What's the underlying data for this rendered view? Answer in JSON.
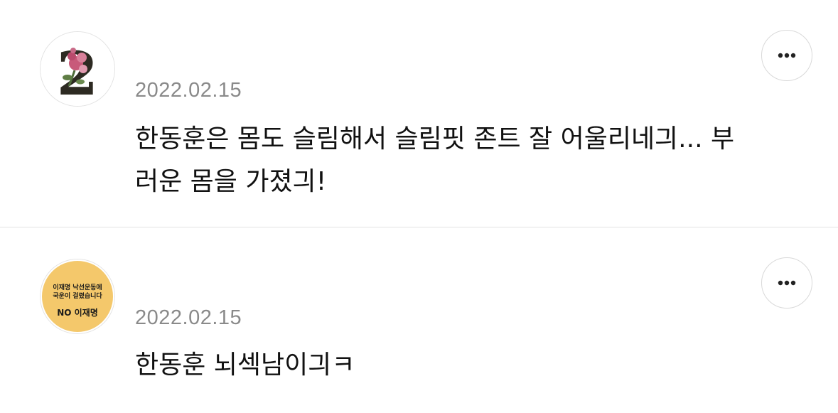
{
  "comments": [
    {
      "date": "2022.02.15",
      "text": "한동훈은 몸도 슬림해서 슬림핏 존트 잘 어울리네긔... 부\n러운 몸을 가졌긔!",
      "avatar_icon": "number-two-rose-avatar-icon"
    },
    {
      "date": "2022.02.15",
      "text": "한동훈 뇌섹남이긔ㅋ",
      "avatar_icon": "no-lee-jae-myung-badge-avatar-icon",
      "avatar_badge": {
        "line1": "이재명 낙선운동에",
        "line2": "국운이 걸렸습니다",
        "line3": "NO 이재명"
      }
    }
  ],
  "colors": {
    "badge_fill": "#f4c86b",
    "date_text": "#8a8a8a",
    "divider": "#e3e3e3"
  }
}
